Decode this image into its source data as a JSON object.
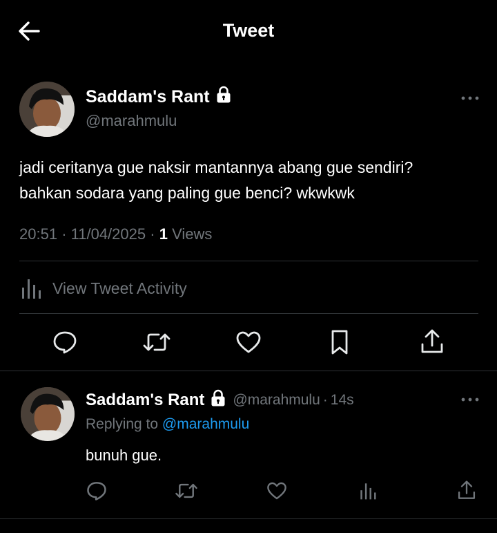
{
  "header": {
    "title": "Tweet",
    "back_icon": "arrow-left-icon"
  },
  "tweet": {
    "author_name": "Saddam's Rant",
    "author_handle": "@marahmulu",
    "protected_icon": "lock-icon",
    "text_lines": [
      "jadi ceritanya gue naksir mantannya abang gue sendiri?",
      "bahkan sodara yang paling gue benci? wkwkwk"
    ],
    "time": "20:51",
    "date": "11/04/2025",
    "sep": "·",
    "views_count": "1",
    "views_label": "Views",
    "activity_label": "View Tweet Activity"
  },
  "actions": [
    "reply-icon",
    "retweet-icon",
    "like-icon",
    "bookmark-icon",
    "share-icon"
  ],
  "reply": {
    "author_name": "Saddam's Rant",
    "author_handle": "@marahmulu",
    "sep": "·",
    "time_ago": "14s",
    "replying_prefix": "Replying to",
    "replying_to": "@marahmulu",
    "text": "bunuh gue.",
    "actions": [
      "reply-icon",
      "retweet-icon",
      "like-icon",
      "analytics-icon",
      "share-icon"
    ]
  },
  "colors": {
    "background": "#000000",
    "text": "#e7e9ea",
    "muted": "#71767b",
    "link": "#1d9bf0",
    "divider": "#2f3336"
  }
}
